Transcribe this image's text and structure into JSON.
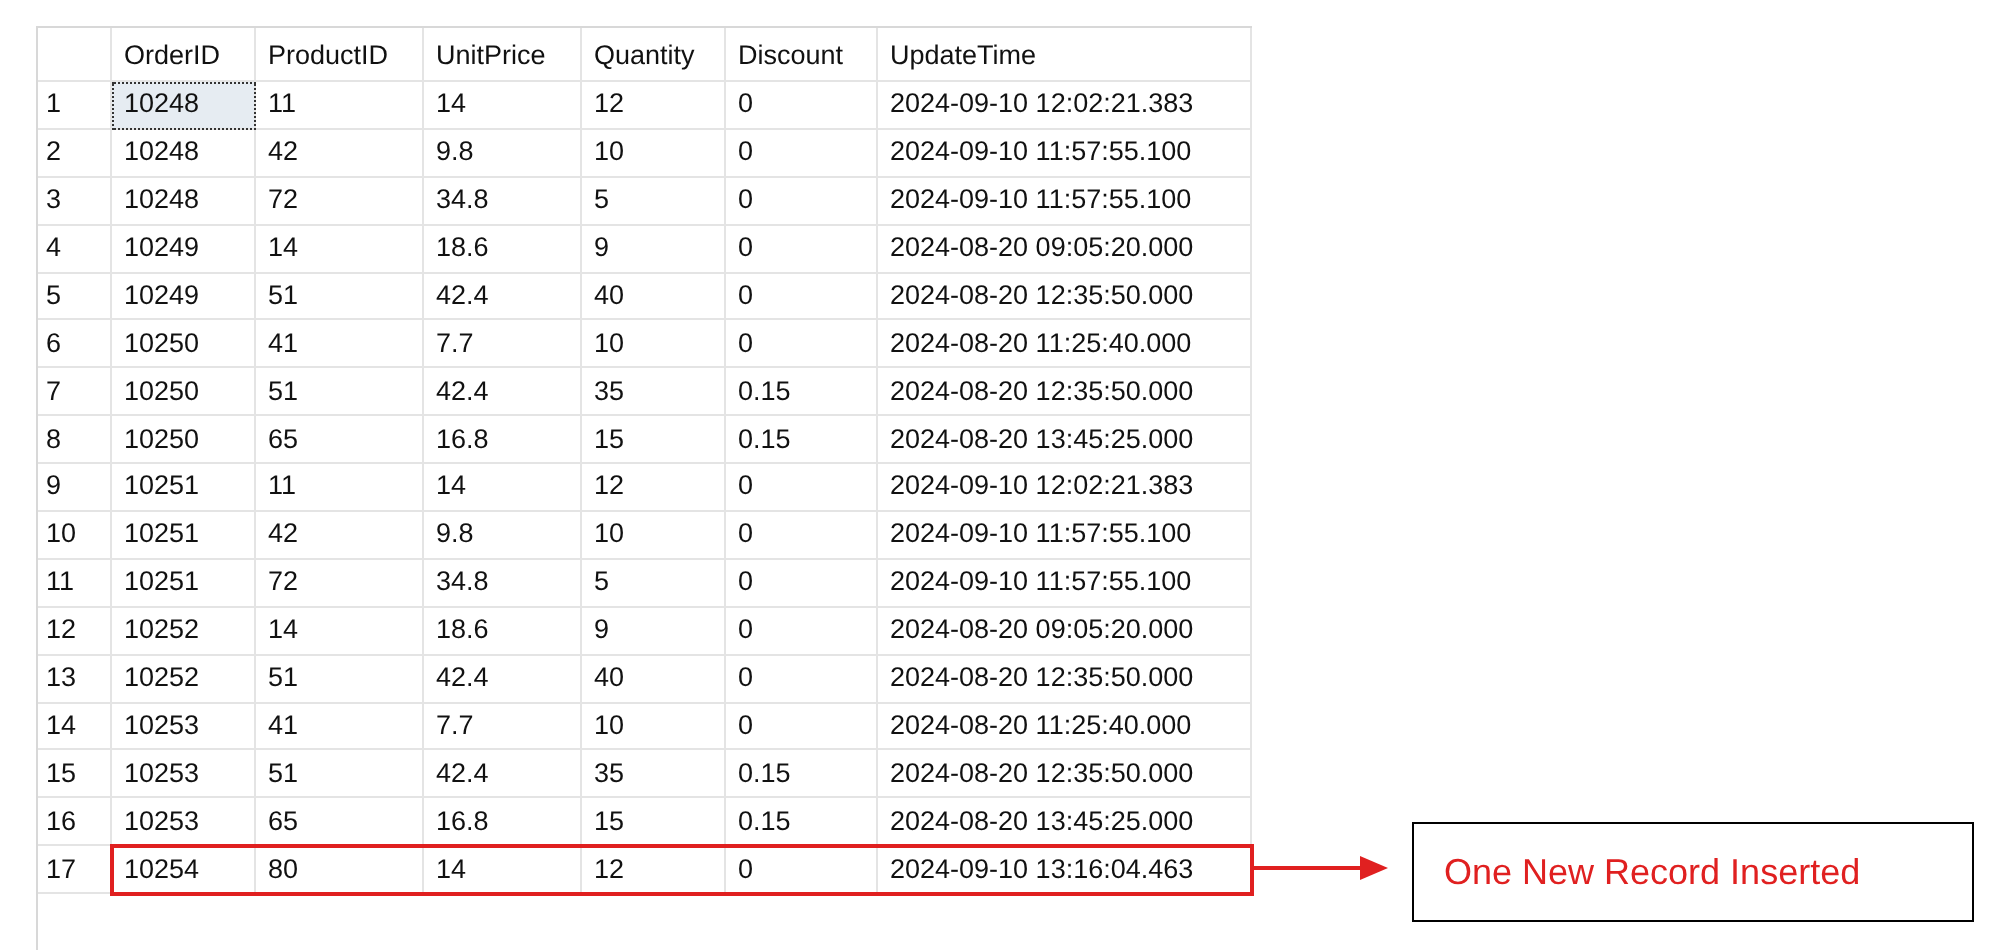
{
  "table": {
    "columns": [
      "OrderID",
      "ProductID",
      "UnitPrice",
      "Quantity",
      "Discount",
      "UpdateTime"
    ],
    "rows": [
      {
        "number": "1",
        "cells": [
          "10248",
          "11",
          "14",
          "12",
          "0",
          "2024-09-10 12:02:21.383"
        ],
        "selected": true,
        "highlighted": false
      },
      {
        "number": "2",
        "cells": [
          "10248",
          "42",
          "9.8",
          "10",
          "0",
          "2024-09-10 11:57:55.100"
        ],
        "selected": false,
        "highlighted": false
      },
      {
        "number": "3",
        "cells": [
          "10248",
          "72",
          "34.8",
          "5",
          "0",
          "2024-09-10 11:57:55.100"
        ],
        "selected": false,
        "highlighted": false
      },
      {
        "number": "4",
        "cells": [
          "10249",
          "14",
          "18.6",
          "9",
          "0",
          "2024-08-20 09:05:20.000"
        ],
        "selected": false,
        "highlighted": false
      },
      {
        "number": "5",
        "cells": [
          "10249",
          "51",
          "42.4",
          "40",
          "0",
          "2024-08-20 12:35:50.000"
        ],
        "selected": false,
        "highlighted": false
      },
      {
        "number": "6",
        "cells": [
          "10250",
          "41",
          "7.7",
          "10",
          "0",
          "2024-08-20 11:25:40.000"
        ],
        "selected": false,
        "highlighted": false
      },
      {
        "number": "7",
        "cells": [
          "10250",
          "51",
          "42.4",
          "35",
          "0.15",
          "2024-08-20 12:35:50.000"
        ],
        "selected": false,
        "highlighted": false
      },
      {
        "number": "8",
        "cells": [
          "10250",
          "65",
          "16.8",
          "15",
          "0.15",
          "2024-08-20 13:45:25.000"
        ],
        "selected": false,
        "highlighted": false
      },
      {
        "number": "9",
        "cells": [
          "10251",
          "11",
          "14",
          "12",
          "0",
          "2024-09-10 12:02:21.383"
        ],
        "selected": false,
        "highlighted": false
      },
      {
        "number": "10",
        "cells": [
          "10251",
          "42",
          "9.8",
          "10",
          "0",
          "2024-09-10 11:57:55.100"
        ],
        "selected": false,
        "highlighted": false
      },
      {
        "number": "11",
        "cells": [
          "10251",
          "72",
          "34.8",
          "5",
          "0",
          "2024-09-10 11:57:55.100"
        ],
        "selected": false,
        "highlighted": false
      },
      {
        "number": "12",
        "cells": [
          "10252",
          "14",
          "18.6",
          "9",
          "0",
          "2024-08-20 09:05:20.000"
        ],
        "selected": false,
        "highlighted": false
      },
      {
        "number": "13",
        "cells": [
          "10252",
          "51",
          "42.4",
          "40",
          "0",
          "2024-08-20 12:35:50.000"
        ],
        "selected": false,
        "highlighted": false
      },
      {
        "number": "14",
        "cells": [
          "10253",
          "41",
          "7.7",
          "10",
          "0",
          "2024-08-20 11:25:40.000"
        ],
        "selected": false,
        "highlighted": false
      },
      {
        "number": "15",
        "cells": [
          "10253",
          "51",
          "42.4",
          "35",
          "0.15",
          "2024-08-20 12:35:50.000"
        ],
        "selected": false,
        "highlighted": false
      },
      {
        "number": "16",
        "cells": [
          "10253",
          "65",
          "16.8",
          "15",
          "0.15",
          "2024-08-20 13:45:25.000"
        ],
        "selected": false,
        "highlighted": false
      },
      {
        "number": "17",
        "cells": [
          "10254",
          "80",
          "14",
          "12",
          "0",
          "2024-09-10 13:16:04.463"
        ],
        "selected": false,
        "highlighted": true
      }
    ]
  },
  "callout": "One New Record Inserted"
}
